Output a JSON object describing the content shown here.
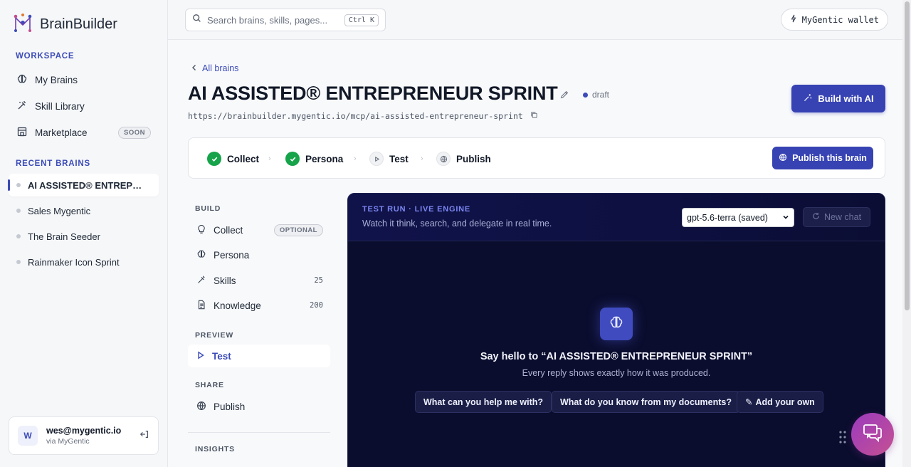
{
  "brand": {
    "name": "BrainBuilder"
  },
  "sidebar": {
    "workspace_label": "WORKSPACE",
    "items": [
      {
        "label": "My Brains",
        "icon": "brain-icon"
      },
      {
        "label": "Skill Library",
        "icon": "wand-icon"
      },
      {
        "label": "Marketplace",
        "icon": "store-icon",
        "badge": "SOON"
      }
    ],
    "recent_label": "RECENT BRAINS",
    "recent": [
      {
        "label": "AI ASSISTED® ENTREPRENEUR SPRINT",
        "active": true
      },
      {
        "label": "Sales Mygentic"
      },
      {
        "label": "The Brain Seeder"
      },
      {
        "label": "Rainmaker Icon Sprint"
      }
    ],
    "user": {
      "initial": "W",
      "email": "wes@mygentic.io",
      "sub": "via MyGentic"
    }
  },
  "topbar": {
    "search_placeholder": "Search brains, skills, pages...",
    "shortcut": "Ctrl K",
    "wallet_label": "MyGentic wallet"
  },
  "page": {
    "back_label": "All brains",
    "title": "AI ASSISTED® ENTREPRENEUR SPRINT",
    "status": "draft",
    "url": "https://brainbuilder.mygentic.io/mcp/ai-assisted-entrepreneur-sprint",
    "build_ai_label": "Build with AI"
  },
  "stepper": {
    "steps": [
      {
        "label": "Collect",
        "state": "done"
      },
      {
        "label": "Persona",
        "state": "done"
      },
      {
        "label": "Test",
        "state": "current"
      },
      {
        "label": "Publish",
        "state": "pending"
      }
    ],
    "publish_label": "Publish this brain"
  },
  "subnav": {
    "build_label": "BUILD",
    "build_items": [
      {
        "label": "Collect",
        "badge": "OPTIONAL"
      },
      {
        "label": "Persona"
      },
      {
        "label": "Skills",
        "count": "25"
      },
      {
        "label": "Knowledge",
        "count": "200"
      }
    ],
    "preview_label": "PREVIEW",
    "preview_items": [
      {
        "label": "Test",
        "active": true
      }
    ],
    "share_label": "SHARE",
    "share_items": [
      {
        "label": "Publish"
      }
    ],
    "insights_label": "INSIGHTS"
  },
  "test_panel": {
    "kicker": "TEST RUN · LIVE ENGINE",
    "subtitle": "Watch it think, search, and delegate in real time.",
    "model": "gpt-5.6-terra (saved)",
    "new_chat_label": "New chat",
    "hello": "Say hello to “AI ASSISTED® ENTREPRENEUR SPRINT”",
    "hello_sub": "Every reply shows exactly how it was produced.",
    "chips": [
      "What can you help me with?",
      "What do you know from my documents?",
      "Add your own"
    ]
  },
  "colors": {
    "accent": "#3743b3",
    "success": "#16a34a",
    "panel_bg": "#0b0d2e",
    "fab": "#b0469f"
  }
}
